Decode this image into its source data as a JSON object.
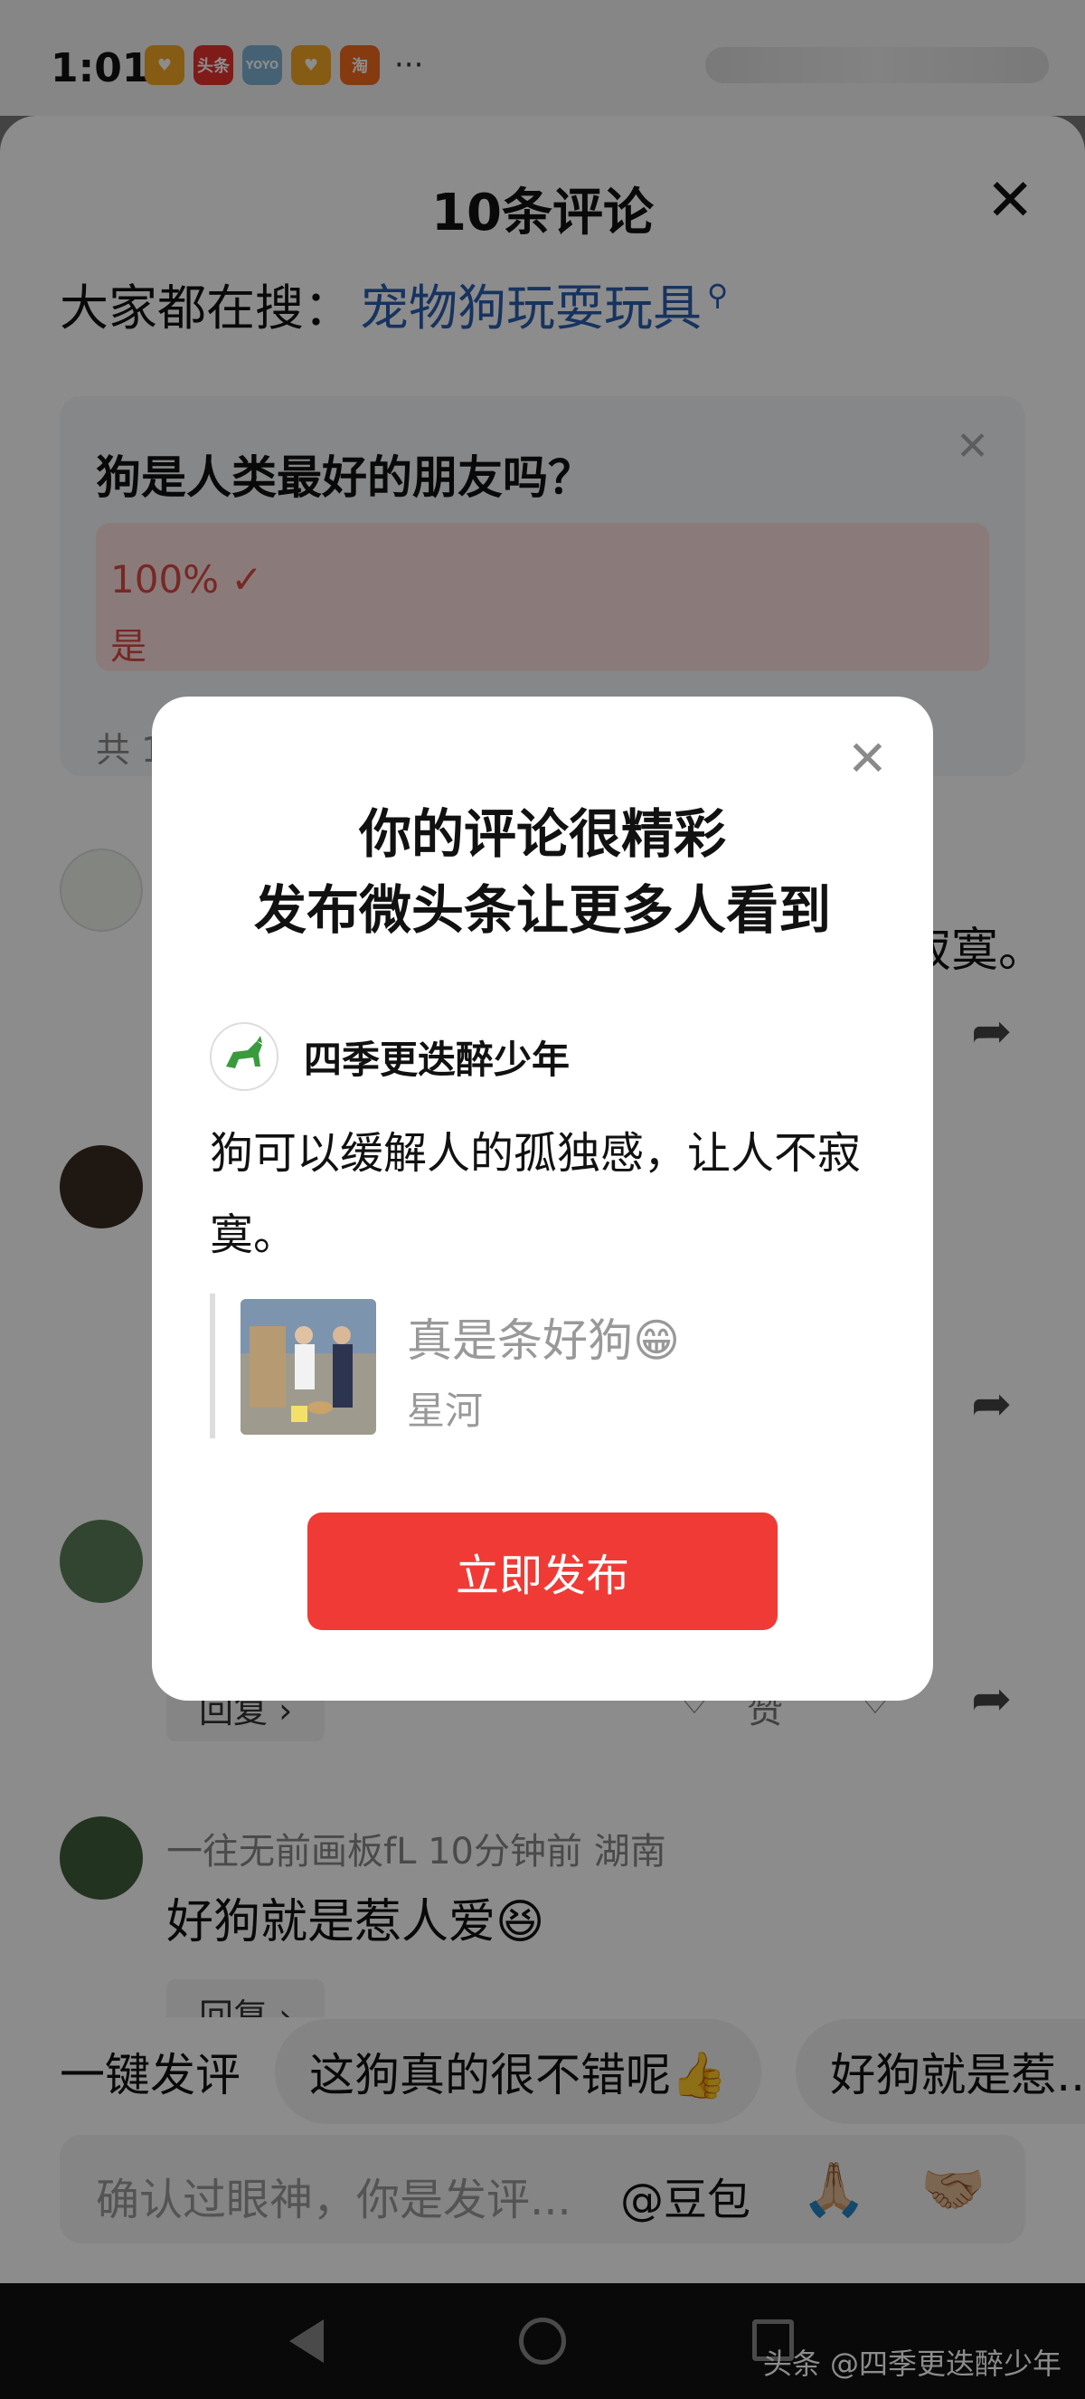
{
  "status_bar": {
    "time": "1:01",
    "app_icons": [
      {
        "name": "heart-app-icon",
        "label": "",
        "color": "#f5a623"
      },
      {
        "name": "toutiao-app-icon",
        "label": "头条",
        "color": "#e8322f"
      },
      {
        "name": "yoyo-app-icon",
        "label": "YOYO",
        "color": "#7fb2d6"
      },
      {
        "name": "heart-app-icon-2",
        "label": "",
        "color": "#f5a623"
      },
      {
        "name": "taobao-app-icon",
        "label": "淘",
        "color": "#f36b1c"
      }
    ],
    "more": "···"
  },
  "sheet": {
    "title": "10条评论",
    "search_prefix": "大家都在搜：",
    "search_term": "宠物狗玩耍玩具",
    "search_icon": "search-icon"
  },
  "poll": {
    "question": "狗是人类最好的朋友吗？",
    "percent": "100% ✓",
    "answer": "是",
    "footer": "共 1"
  },
  "comments": {
    "visible_tail": "寂寞。",
    "reply_label": "回复 ›",
    "like_label": "赞",
    "last": {
      "name_meta": "一往无前画板fL   10分钟前   湖南",
      "text": "好狗就是惹人爱😆"
    }
  },
  "quick_reply": {
    "label": "一键发评",
    "chips": [
      "这狗真的很不错呢👍",
      "好狗就是惹..."
    ]
  },
  "input": {
    "placeholder": "确认过眼神，你是发评...",
    "at_label": "@豆包",
    "emoji1": "🙏🏼",
    "emoji2": "🤝🏼"
  },
  "modal": {
    "title_line1": "你的评论很精彩",
    "title_line2": "发布微头条让更多人看到",
    "user_name": "四季更迭醉少年",
    "comment": "狗可以缓解人的孤独感，让人不寂寞。",
    "quote_title": "真是条好狗😁",
    "quote_author": "星河",
    "publish_button": "立即发布",
    "close_icon": "close-icon"
  },
  "watermark": "头条 @四季更迭醉少年",
  "colors": {
    "accent_red": "#f03a36",
    "link_blue": "#2a5db0",
    "poll_red": "#d94a44"
  }
}
